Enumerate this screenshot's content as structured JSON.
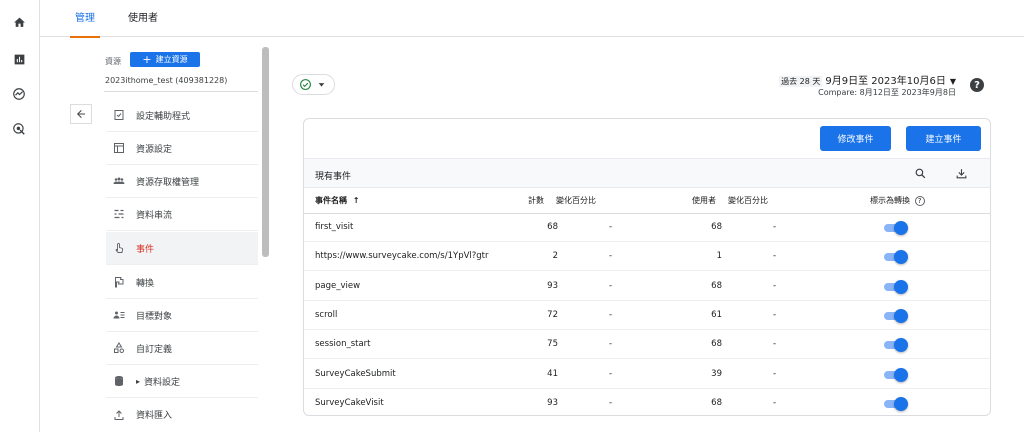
{
  "tabs": {
    "admin": "管理",
    "users": "使用者"
  },
  "account": {
    "resource_label": "資源",
    "create_resource": "建立資源",
    "create_resource_plus": "+",
    "name": "2023ithome_test (409381228)"
  },
  "nav": {
    "items": [
      {
        "label": "設定輔助程式",
        "icon": "checklist-icon"
      },
      {
        "label": "資源設定",
        "icon": "property-settings-icon"
      },
      {
        "label": "資源存取權管理",
        "icon": "people-icon"
      },
      {
        "label": "資料串流",
        "icon": "data-stream-icon"
      },
      {
        "label": "事件",
        "icon": "touch-icon"
      },
      {
        "label": "轉換",
        "icon": "flag-icon"
      },
      {
        "label": "目標對象",
        "icon": "audience-icon"
      },
      {
        "label": "自訂定義",
        "icon": "shapes-icon"
      },
      {
        "label": "資料設定",
        "icon": "database-icon",
        "caret": "▸"
      },
      {
        "label": "資料匯入",
        "icon": "upload-icon"
      }
    ],
    "active_index": 4
  },
  "date": {
    "period": "過去 28 天",
    "range": "9月9日至 2023年10月6日",
    "caret": "▼",
    "compare": "Compare: 8月12日至 2023年9月8日"
  },
  "help": "?",
  "card": {
    "modify_button": "修改事件",
    "create_button": "建立事件",
    "title": "現有事件",
    "columns": {
      "name": "事件名稱",
      "name_sort": "↑",
      "count": "計數",
      "count_change": "變化百分比",
      "users": "使用者",
      "users_change": "變化百分比",
      "conversion": "標示為轉換",
      "conversion_help": "?"
    },
    "rows": [
      {
        "name": "first_visit",
        "count": "68",
        "count_change": "-",
        "users": "68",
        "users_change": "-",
        "conversion": true
      },
      {
        "name": "https://www.surveycake.com/s/1YpVl?gtr",
        "count": "2",
        "count_change": "-",
        "users": "1",
        "users_change": "-",
        "conversion": true
      },
      {
        "name": "page_view",
        "count": "93",
        "count_change": "-",
        "users": "68",
        "users_change": "-",
        "conversion": true
      },
      {
        "name": "scroll",
        "count": "72",
        "count_change": "-",
        "users": "61",
        "users_change": "-",
        "conversion": true
      },
      {
        "name": "session_start",
        "count": "75",
        "count_change": "-",
        "users": "68",
        "users_change": "-",
        "conversion": true
      },
      {
        "name": "SurveyCakeSubmit",
        "count": "41",
        "count_change": "-",
        "users": "39",
        "users_change": "-",
        "conversion": true
      },
      {
        "name": "SurveyCakeVisit",
        "count": "93",
        "count_change": "-",
        "users": "68",
        "users_change": "-",
        "conversion": true
      }
    ]
  },
  "colors": {
    "accent": "#1a73e8",
    "tab_underline": "#e8710a",
    "active_nav_text": "#d93025",
    "check_green": "#188038"
  }
}
